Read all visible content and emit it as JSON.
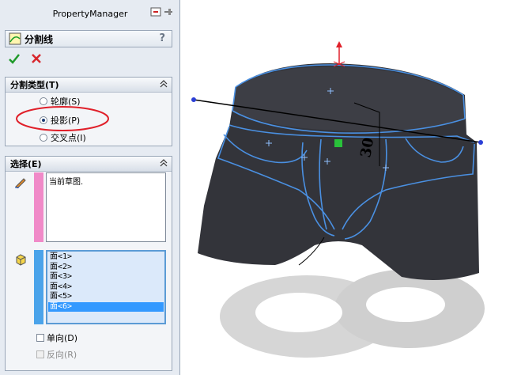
{
  "panel": {
    "title": "PropertyManager",
    "feature_name": "分割线",
    "help": "?"
  },
  "split_type": {
    "header": "分割类型(T)",
    "options": [
      {
        "label": "轮廓(S)",
        "selected": false
      },
      {
        "label": "投影(P)",
        "selected": true
      },
      {
        "label": "交叉点(I)",
        "selected": false
      }
    ]
  },
  "selection": {
    "header": "选择(E)",
    "sketch_value": "当前草图.",
    "faces": [
      "面<1>",
      "面<2>",
      "面<3>",
      "面<4>",
      "面<5>",
      "面<6>"
    ],
    "selected_face_index": 5,
    "single_direction": "单向(D)",
    "reverse": "反向(R)"
  },
  "viewport": {
    "dimension": "30",
    "colors": {
      "curve": "#4a90e2",
      "mesh": "#33343a",
      "axis_red": "#e0202a",
      "handle": "#2b3fd6",
      "marker": "#29c23a"
    }
  }
}
